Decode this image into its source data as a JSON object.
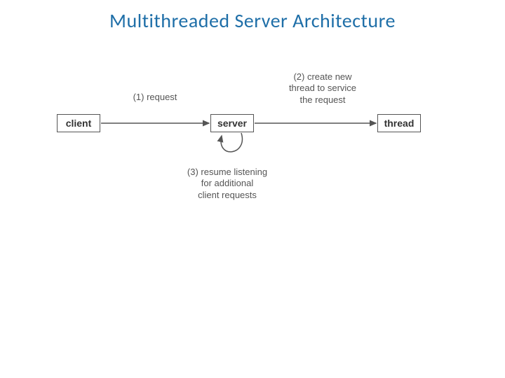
{
  "title": "Multithreaded Server Architecture",
  "nodes": {
    "client": "client",
    "server": "server",
    "thread": "thread"
  },
  "labels": {
    "request": "(1) request",
    "create_line1": "(2) create new",
    "create_line2": "thread to service",
    "create_line3": "the request",
    "resume_line1": "(3) resume listening",
    "resume_line2": "for additional",
    "resume_line3": "client requests"
  }
}
